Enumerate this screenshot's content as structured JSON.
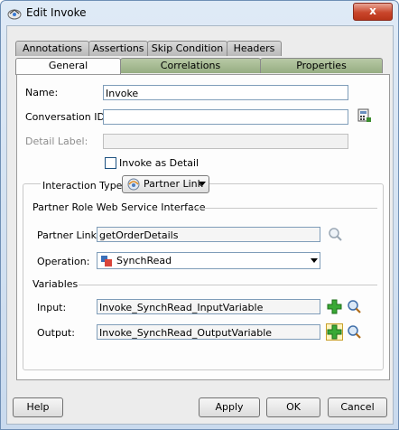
{
  "window": {
    "title": "Edit Invoke",
    "close_glyph": "x"
  },
  "tabs_back": [
    "Annotations",
    "Assertions",
    "Skip Condition",
    "Headers"
  ],
  "tabs_front": [
    "General",
    "Correlations",
    "Properties"
  ],
  "form": {
    "name_label": "Name:",
    "name_value": "Invoke",
    "conversation_label": "Conversation ID:",
    "conversation_value": "",
    "detail_label": "Detail Label:",
    "detail_value": "",
    "invoke_as_detail_label": "Invoke as Detail",
    "interaction_type_label": "Interaction Type:",
    "interaction_type_value": "Partner Link"
  },
  "partner_section": {
    "title": "Partner Role Web Service Interface",
    "partner_link_label": "Partner Link:",
    "partner_link_value": "getOrderDetails",
    "operation_label": "Operation:",
    "operation_value": "SynchRead"
  },
  "variables_section": {
    "title": "Variables",
    "input_label": "Input:",
    "input_value": "Invoke_SynchRead_InputVariable",
    "output_label": "Output:",
    "output_value": "Invoke_SynchRead_OutputVariable"
  },
  "buttons": {
    "help": "Help",
    "apply": "Apply",
    "ok": "OK",
    "cancel": "Cancel"
  },
  "colors": {
    "active_tab_green": "#96ad82",
    "title_gradient": "#c9daee",
    "close_red": "#c9462b"
  }
}
